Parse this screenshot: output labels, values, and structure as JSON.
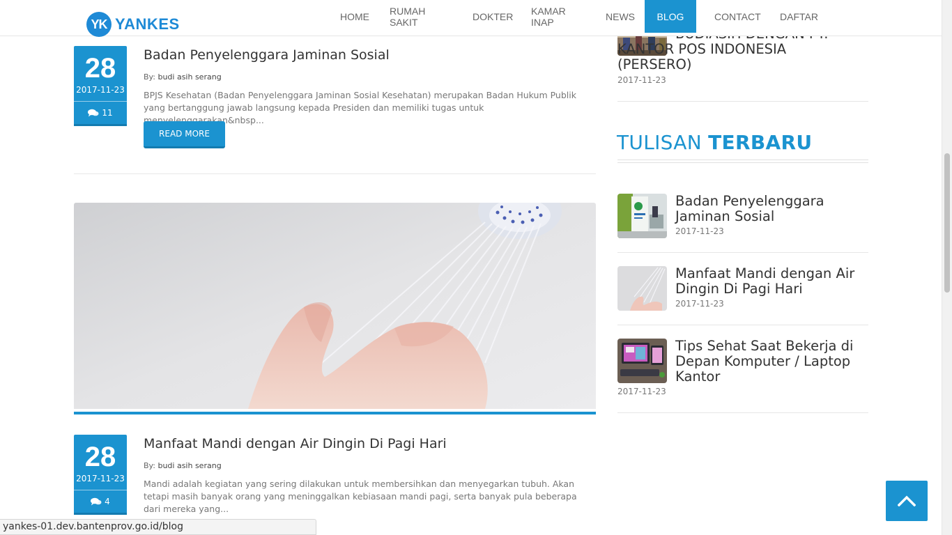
{
  "header": {
    "logo_mark": "YK",
    "logo_text": "YANKES",
    "nav": [
      "HOME",
      "RUMAH SAKIT",
      "DOKTER",
      "KAMAR INAP",
      "NEWS",
      "BLOG",
      "CONTACT",
      "DAFTAR"
    ],
    "active_nav": "BLOG"
  },
  "posts": [
    {
      "day": "28",
      "date": "2017-11-23",
      "comments": "11",
      "title": "Badan Penyelenggara Jaminan Sosial",
      "by_label": "By:",
      "author": "budi asih serang",
      "excerpt": "BPJS Kesehatan (Badan Penyelenggara Jaminan Sosial Kesehatan) merupakan Badan Hukum Publik yang bertanggung jawab langsung kepada Presiden dan memiliki tugas untuk menyelenggarakan&nbsp...",
      "read_more": "READ MORE"
    },
    {
      "day": "28",
      "date": "2017-11-23",
      "comments": "4",
      "title": "Manfaat Mandi dengan Air Dingin Di Pagi Hari",
      "by_label": "By:",
      "author": "budi asih serang",
      "excerpt": "Mandi adalah kegiatan yang sering dilakukan untuk membersihkan dan menyegarkan tubuh. Akan tetapi masih banyak orang yang meninggalkan kebiasaan mandi pagi, serta banyak pula beberapa dari mereka yang..."
    }
  ],
  "sidebar": {
    "top_item": {
      "title": "BUDIASIH DENGAN PT. KANTOR POS INDONESIA (PERSERO)",
      "date": "2017-11-23"
    },
    "heading_light": "TULISAN",
    "heading_bold": "TERBARU",
    "recent": [
      {
        "title": "Badan Penyelenggara Jaminan Sosial",
        "date": "2017-11-23"
      },
      {
        "title": "Manfaat Mandi dengan Air Dingin Di Pagi Hari",
        "date": "2017-11-23"
      },
      {
        "title": "Tips Sehat Saat Bekerja di Depan Komputer / Laptop Kantor",
        "date": "2017-11-23"
      }
    ]
  },
  "status_url": "yankes-01.dev.bantenprov.go.id/blog",
  "colors": {
    "accent": "#1b93d0",
    "logo": "#1e8ad6"
  }
}
